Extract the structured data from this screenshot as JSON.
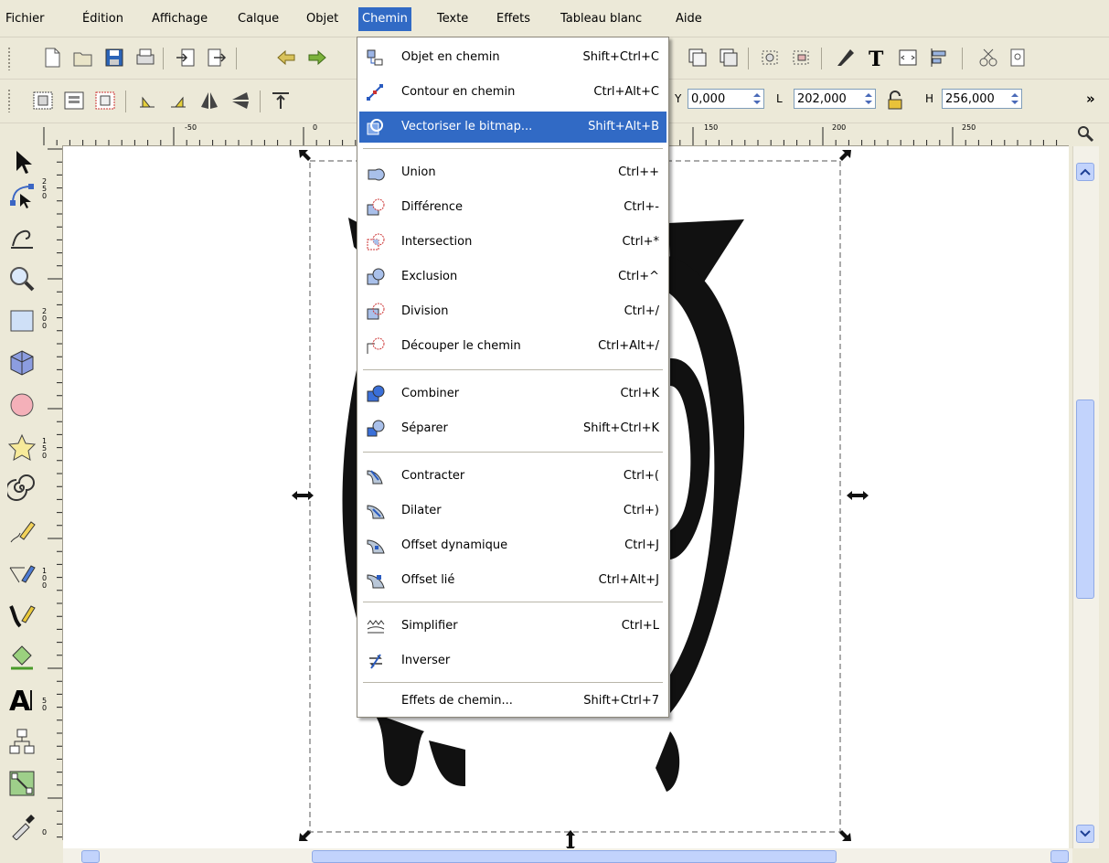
{
  "menubar": {
    "items": [
      {
        "label": "Fichier"
      },
      {
        "label": "Édition"
      },
      {
        "label": "Affichage"
      },
      {
        "label": "Calque"
      },
      {
        "label": "Objet"
      },
      {
        "label": "Chemin"
      },
      {
        "label": "Texte"
      },
      {
        "label": "Effets"
      },
      {
        "label": "Tableau blanc"
      },
      {
        "label": "Aide"
      }
    ],
    "active": "Chemin"
  },
  "controls": {
    "y_label": "Y",
    "y_value": "0,000",
    "w_label": "L",
    "w_value": "202,000",
    "h_label": "H",
    "h_value": "256,000",
    "more": "»"
  },
  "ruler": {
    "h_ticks": [
      "-50",
      "0",
      "150",
      "200",
      "250"
    ],
    "v_ticks": [
      "2 5 0",
      "2 0 0",
      "1 5 0",
      "1 0 0",
      "5 0",
      "0"
    ]
  },
  "path_menu": {
    "items": [
      {
        "label": "Objet en chemin",
        "shortcut": "Shift+Ctrl+C",
        "icon": "object-to-path-icon"
      },
      {
        "label": "Contour en chemin",
        "shortcut": "Ctrl+Alt+C",
        "icon": "stroke-to-path-icon"
      },
      {
        "label": "Vectoriser le bitmap...",
        "shortcut": "Shift+Alt+B",
        "icon": "trace-bitmap-icon",
        "highlighted": true
      },
      {
        "label": "Union",
        "shortcut": "Ctrl++",
        "icon": "union-icon"
      },
      {
        "label": "Différence",
        "shortcut": "Ctrl+-",
        "icon": "difference-icon"
      },
      {
        "label": "Intersection",
        "shortcut": "Ctrl+*",
        "icon": "intersection-icon"
      },
      {
        "label": "Exclusion",
        "shortcut": "Ctrl+^",
        "icon": "exclusion-icon"
      },
      {
        "label": "Division",
        "shortcut": "Ctrl+/",
        "icon": "division-icon"
      },
      {
        "label": "Découper le chemin",
        "shortcut": "Ctrl+Alt+/",
        "icon": "cut-path-icon"
      },
      {
        "label": "Combiner",
        "shortcut": "Ctrl+K",
        "icon": "combine-icon"
      },
      {
        "label": "Séparer",
        "shortcut": "Shift+Ctrl+K",
        "icon": "break-apart-icon"
      },
      {
        "label": "Contracter",
        "shortcut": "Ctrl+(",
        "icon": "inset-icon"
      },
      {
        "label": "Dilater",
        "shortcut": "Ctrl+)",
        "icon": "outset-icon"
      },
      {
        "label": "Offset dynamique",
        "shortcut": "Ctrl+J",
        "icon": "dynamic-offset-icon"
      },
      {
        "label": "Offset lié",
        "shortcut": "Ctrl+Alt+J",
        "icon": "linked-offset-icon"
      },
      {
        "label": "Simplifier",
        "shortcut": "Ctrl+L",
        "icon": "simplify-icon"
      },
      {
        "label": "Inverser",
        "shortcut": "",
        "icon": "reverse-icon"
      },
      {
        "label": "Effets de chemin...",
        "shortcut": "Shift+Ctrl+7",
        "icon": ""
      }
    ]
  },
  "colors": {
    "highlight": "#316ac5",
    "chrome": "#ece9d8",
    "canvas": "#ffffff"
  }
}
